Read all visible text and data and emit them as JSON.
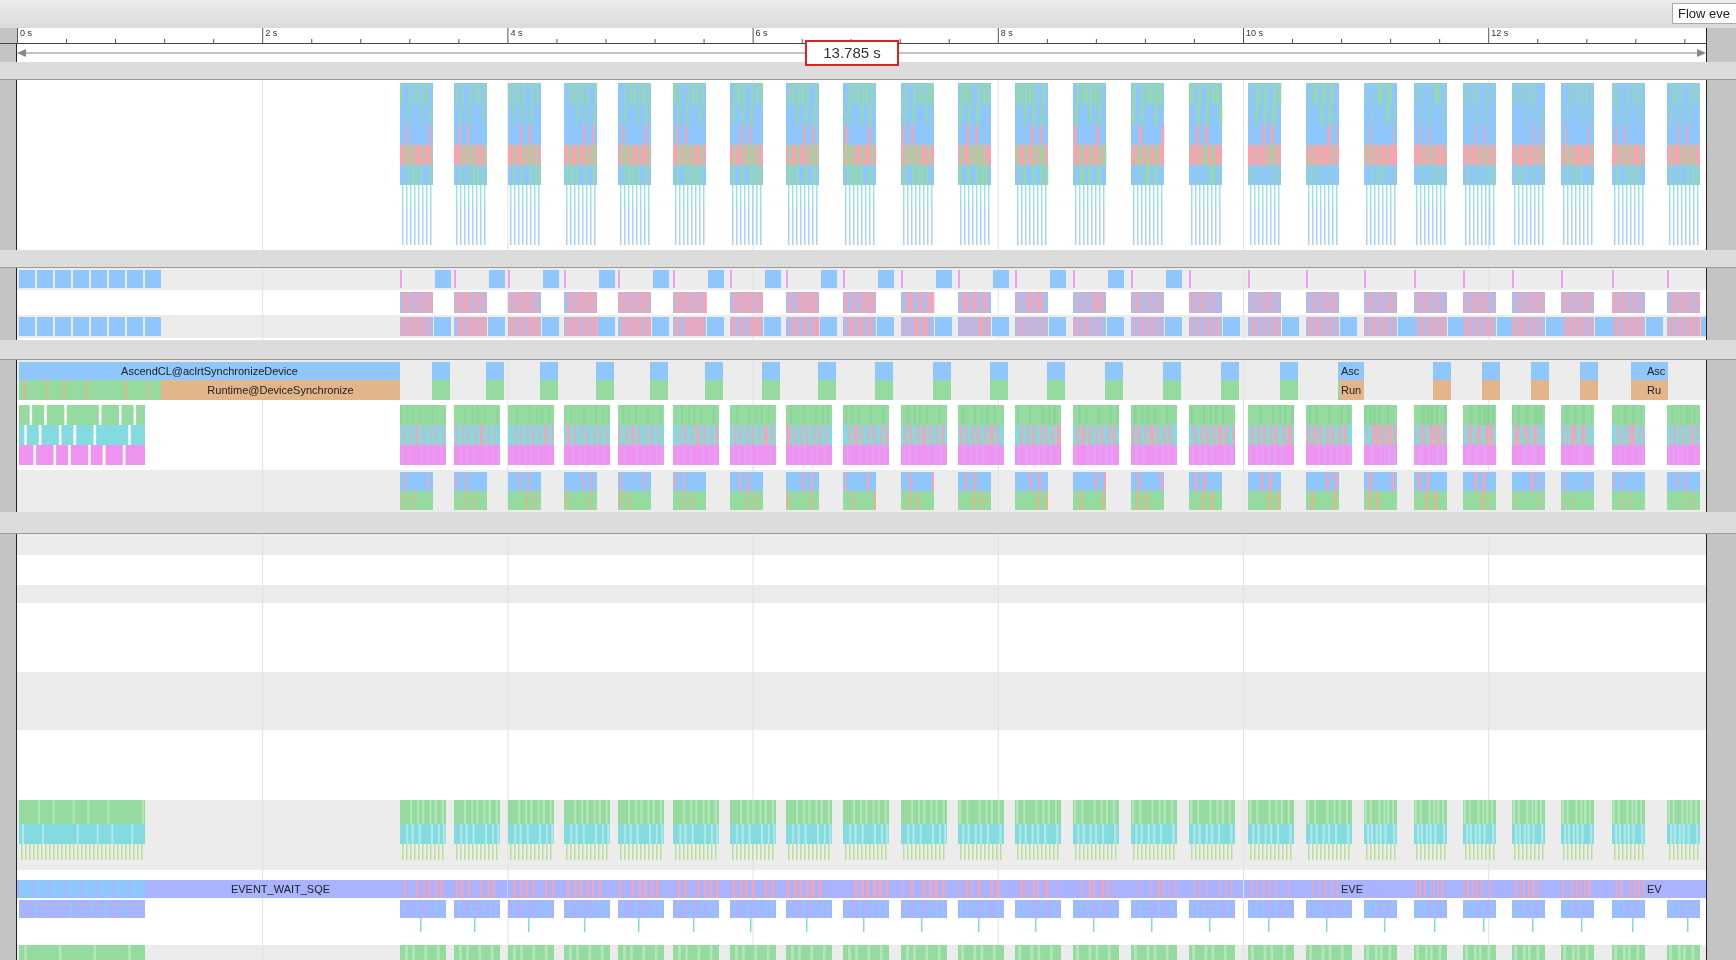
{
  "toolbar": {
    "button": "Flow eve"
  },
  "ruler": {
    "ticks": [
      "0 s",
      "2 s",
      "4 s",
      "6 s",
      "8 s",
      "10 s",
      "12 s"
    ]
  },
  "measurement": {
    "label": "13.785 s"
  },
  "panels": [
    {
      "kind": "stack"
    },
    {
      "kind": "rows"
    },
    {
      "kind": "sync",
      "slices": [
        {
          "label": "AscendCL@aclrtSynchronizeDevice"
        },
        {
          "label": "Runtime@DeviceSynchronize"
        },
        {
          "label": "Asc"
        },
        {
          "label": "Run"
        },
        {
          "label": "Asc"
        },
        {
          "label": "Ru"
        }
      ]
    },
    {
      "kind": "events",
      "slices": [
        {
          "label": "EVENT_WAIT_SQE"
        },
        {
          "label": "EVE"
        },
        {
          "label": "EV"
        }
      ]
    }
  ]
}
